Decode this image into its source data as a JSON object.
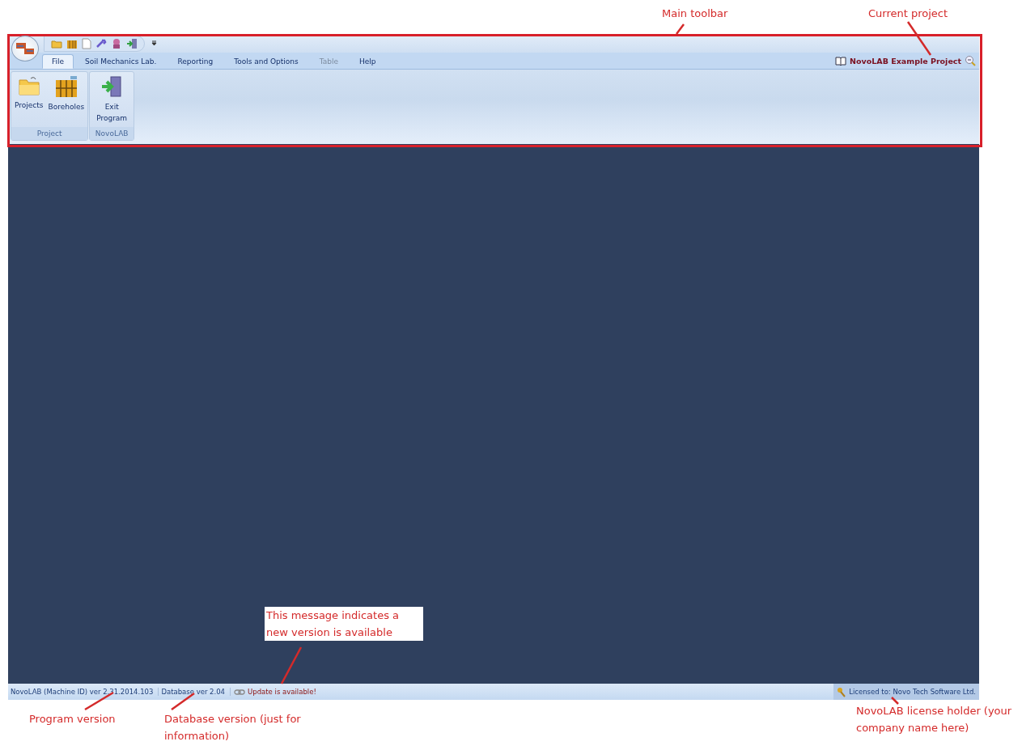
{
  "annotations": [
    {
      "text": "Main toolbar"
    },
    {
      "text": "Current project"
    },
    {
      "text": "This message indicates a new version is available"
    },
    {
      "text": "Program version"
    },
    {
      "text": "Database version (just for information)"
    },
    {
      "text": "NovoLAB license holder (your company name here)"
    }
  ],
  "tabs": [
    {
      "label": "File",
      "selected": true,
      "disabled": false
    },
    {
      "label": "Soil Mechanics Lab.",
      "selected": false,
      "disabled": false
    },
    {
      "label": "Reporting",
      "selected": false,
      "disabled": false
    },
    {
      "label": "Tools and Options",
      "selected": false,
      "disabled": false
    },
    {
      "label": "Table",
      "selected": false,
      "disabled": true
    },
    {
      "label": "Help",
      "selected": false,
      "disabled": false
    }
  ],
  "current_project": "NovoLAB Example Project",
  "ribbon_groups": [
    {
      "label": "Project",
      "buttons": [
        {
          "label": "Projects",
          "kind": "folder"
        },
        {
          "label": "Boreholes",
          "kind": "boreholes"
        }
      ]
    },
    {
      "label": "NovoLAB",
      "buttons": [
        {
          "label": "Exit Program",
          "kind": "exit"
        }
      ]
    }
  ],
  "status_bar": [
    {
      "kind": "text",
      "text": "NovoLAB (Machine ID) ver 2.31.2014.103"
    },
    {
      "kind": "text",
      "text": "Database ver 2.04"
    },
    {
      "kind": "alert",
      "text": "Update is available!"
    },
    {
      "kind": "license",
      "text": "Licensed to: Novo Tech Software Ltd."
    }
  ]
}
